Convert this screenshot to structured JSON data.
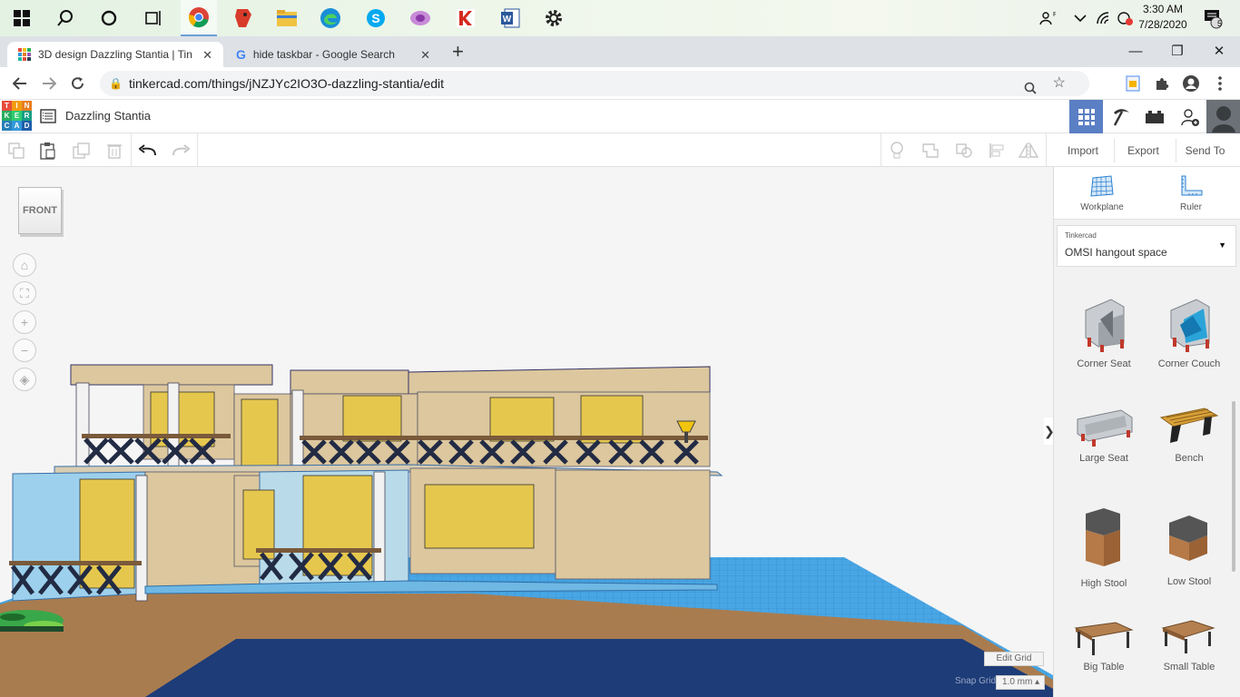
{
  "taskbar": {
    "time": "3:30 AM",
    "date": "7/28/2020",
    "notification_count": "5"
  },
  "tabs": [
    {
      "title": "3D design Dazzling Stantia | Tinkercad"
    },
    {
      "title": "hide taskbar - Google Search"
    }
  ],
  "address": {
    "url": "tinkercad.com/things/jNZJYc2IO3O-dazzling-stantia/edit"
  },
  "tinkercad": {
    "logo": [
      "T",
      "I",
      "N",
      "K",
      "E",
      "R",
      "C",
      "A",
      "D"
    ],
    "project_name": "Dazzling Stantia",
    "buttons": {
      "import": "Import",
      "export": "Export",
      "send_to": "Send To"
    },
    "view_cube": "FRONT"
  },
  "sidebar": {
    "workplane": "Workplane",
    "ruler": "Ruler",
    "library_label": "Tinkercad",
    "library_value": "OMSI hangout space",
    "shapes": [
      {
        "label": "Corner Seat"
      },
      {
        "label": "Corner Couch"
      },
      {
        "label": "Large Seat"
      },
      {
        "label": "Bench"
      },
      {
        "label": "High Stool"
      },
      {
        "label": "Low Stool"
      },
      {
        "label": "Big Table"
      },
      {
        "label": "Small Table"
      }
    ]
  },
  "grid": {
    "edit_grid": "Edit Grid",
    "snap_grid_label": "Snap Grid",
    "snap_value": "1.0 mm"
  },
  "colors": {
    "accent": "#5b7fc4",
    "workplane": "#4aa8e8",
    "walls": "#dcc79e",
    "windows": "#e6c74e"
  }
}
